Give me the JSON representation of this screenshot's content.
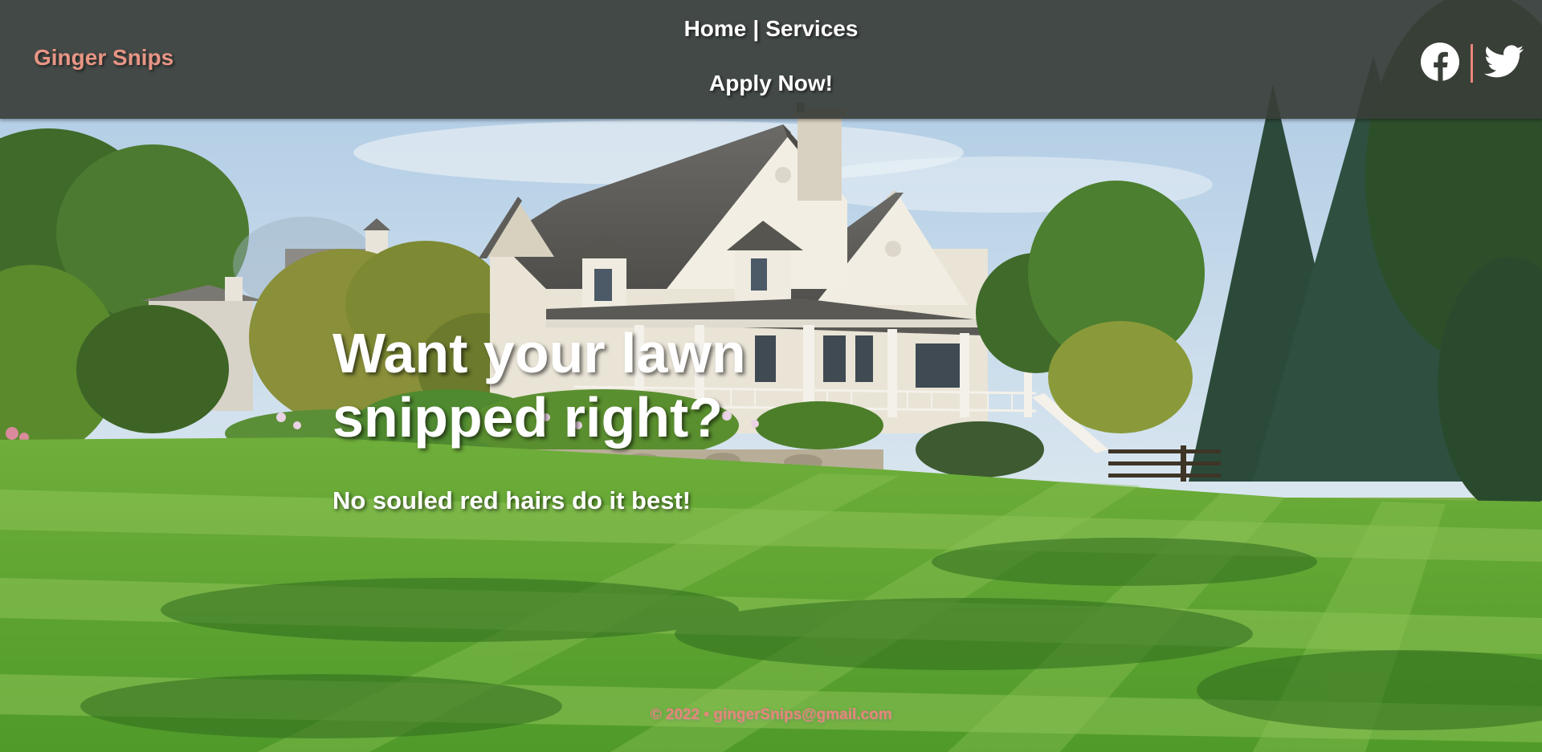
{
  "brand": {
    "name": "Ginger Snips"
  },
  "nav": {
    "home": "Home",
    "separator": "|",
    "services": "Services",
    "apply": "Apply Now!"
  },
  "social": {
    "facebook_icon": "facebook-icon",
    "twitter_icon": "twitter-icon"
  },
  "hero": {
    "title_line1": "Want your lawn",
    "title_line2": "snipped right?",
    "subtitle": "No souled red hairs do it best!"
  },
  "footer": {
    "copyright": "© 2022 •",
    "email": "gingerSnips@gmail.com"
  },
  "colors": {
    "header_bg": "#3a3e38",
    "brand_accent": "#e89585",
    "footer_accent": "#e8857a",
    "text_primary": "#ffffff"
  }
}
